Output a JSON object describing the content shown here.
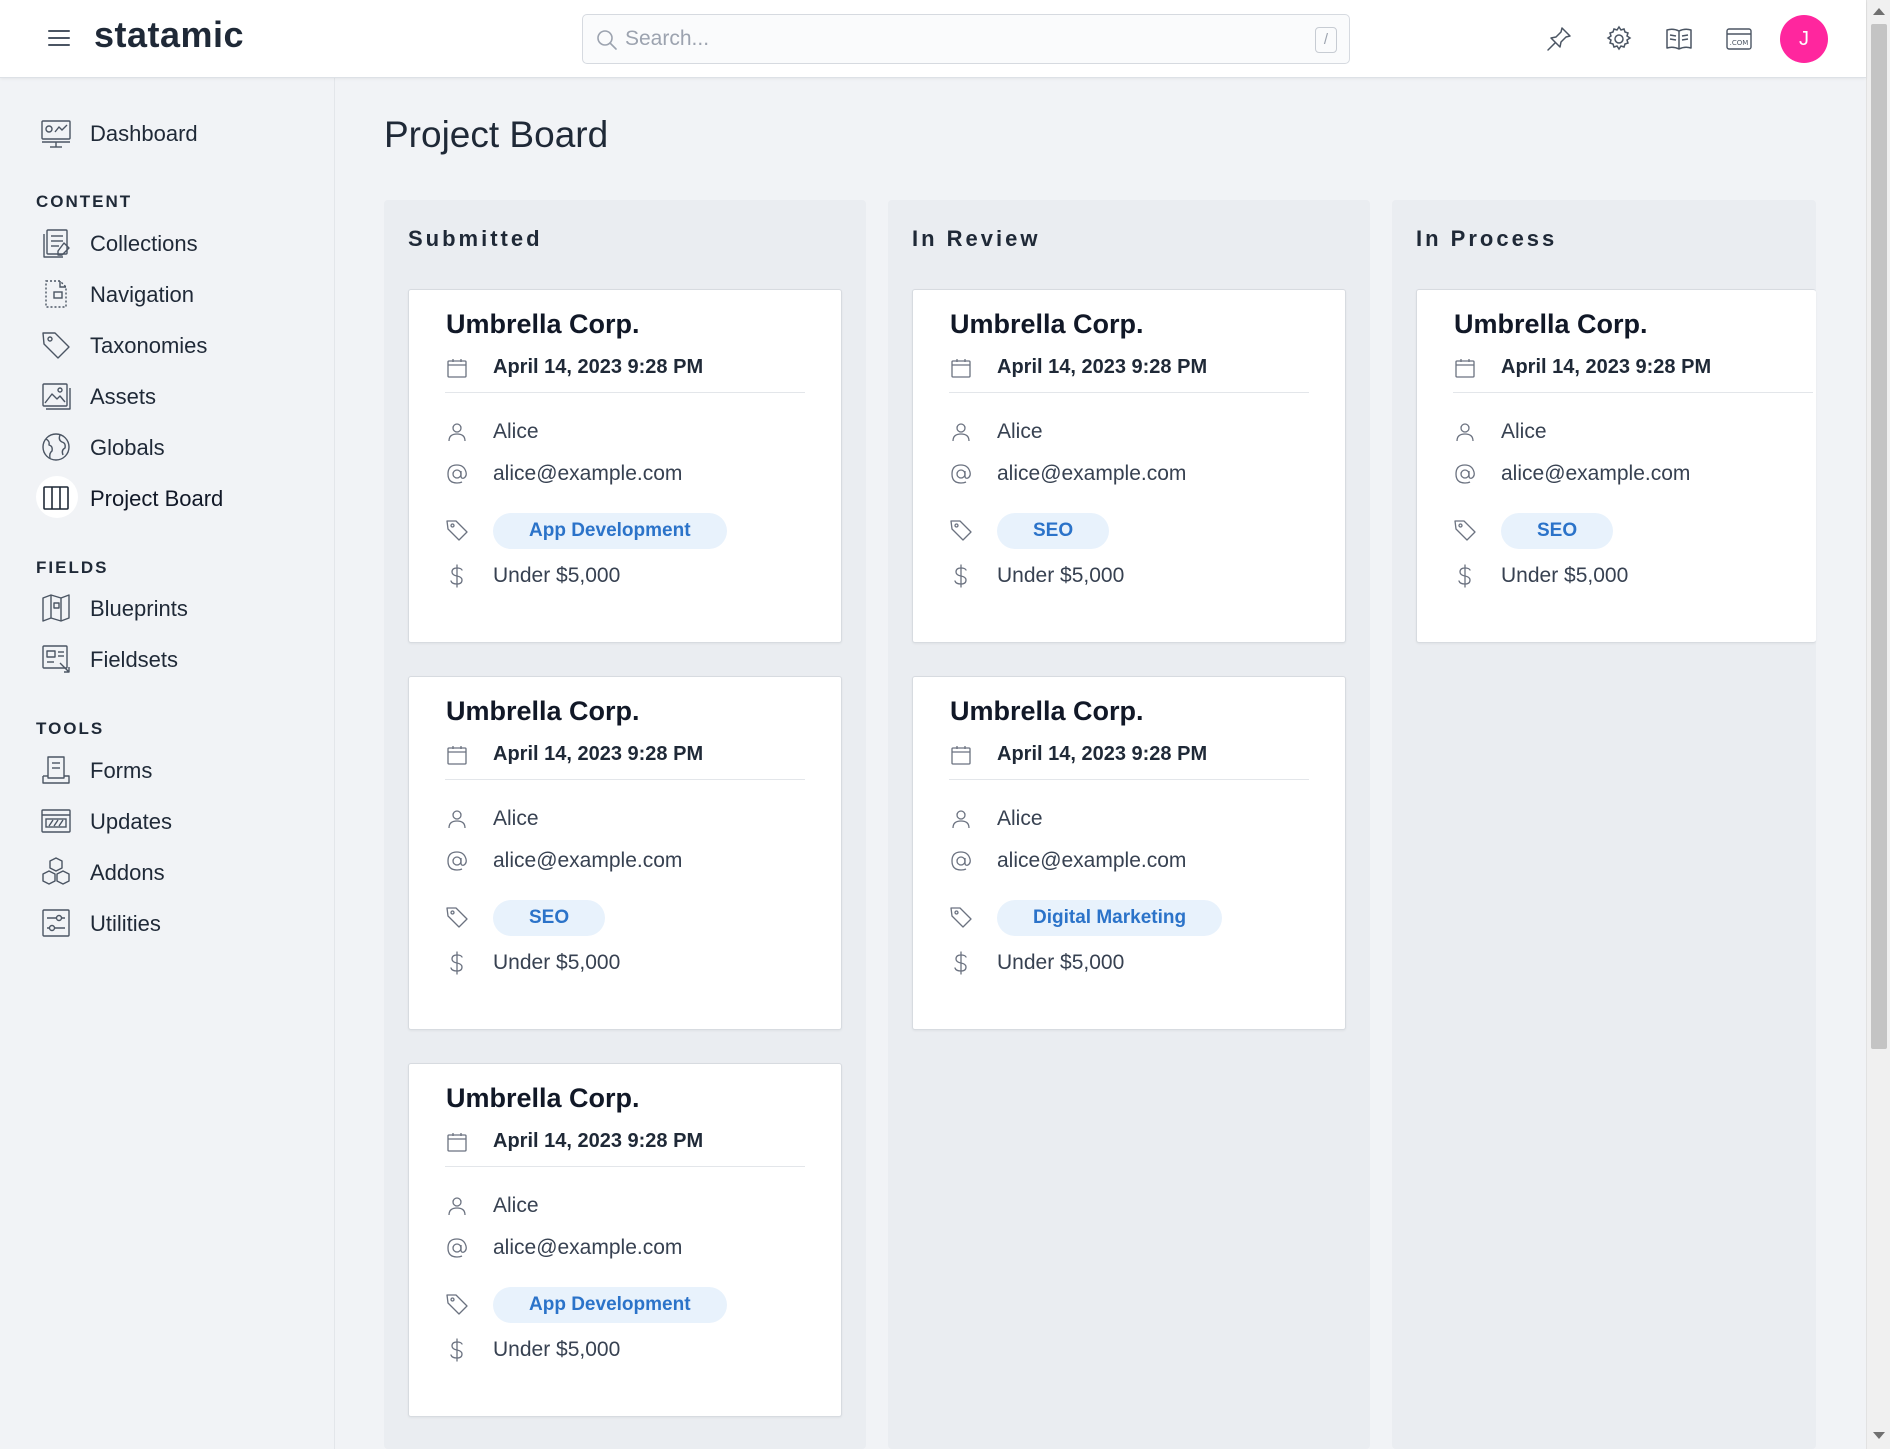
{
  "header": {
    "brand": "statamic",
    "search_placeholder": "Search...",
    "search_shortcut": "/",
    "icons": [
      "pin-icon",
      "gear-icon",
      "book-icon",
      "site-com-icon"
    ],
    "avatar_initial": "J",
    "avatar_color": "#ff269e"
  },
  "sidebar": {
    "dashboard": "Dashboard",
    "content_title": "CONTENT",
    "content_items": [
      {
        "label": "Collections",
        "icon": "collections-icon"
      },
      {
        "label": "Navigation",
        "icon": "navigation-icon"
      },
      {
        "label": "Taxonomies",
        "icon": "tag-icon"
      },
      {
        "label": "Assets",
        "icon": "assets-icon"
      },
      {
        "label": "Globals",
        "icon": "globe-icon"
      },
      {
        "label": "Project Board",
        "icon": "board-icon",
        "active": true
      }
    ],
    "fields_title": "FIELDS",
    "fields_items": [
      {
        "label": "Blueprints",
        "icon": "blueprint-icon"
      },
      {
        "label": "Fieldsets",
        "icon": "fieldset-icon"
      }
    ],
    "tools_title": "TOOLS",
    "tools_items": [
      {
        "label": "Forms",
        "icon": "forms-icon"
      },
      {
        "label": "Updates",
        "icon": "updates-icon"
      },
      {
        "label": "Addons",
        "icon": "addons-icon"
      },
      {
        "label": "Utilities",
        "icon": "utilities-icon"
      }
    ]
  },
  "main": {
    "title": "Project Board",
    "tag_color": "#2b73c9",
    "columns": [
      {
        "title": "Submitted",
        "cards": [
          {
            "company": "Umbrella Corp.",
            "date": "April 14, 2023 9:28 PM",
            "name": "Alice",
            "email": "alice@example.com",
            "tag": "App Development",
            "budget": "Under $5,000"
          },
          {
            "company": "Umbrella Corp.",
            "date": "April 14, 2023 9:28 PM",
            "name": "Alice",
            "email": "alice@example.com",
            "tag": "SEO",
            "budget": "Under $5,000"
          },
          {
            "company": "Umbrella Corp.",
            "date": "April 14, 2023 9:28 PM",
            "name": "Alice",
            "email": "alice@example.com",
            "tag": "App Development",
            "budget": "Under $5,000"
          }
        ]
      },
      {
        "title": "In Review",
        "cards": [
          {
            "company": "Umbrella Corp.",
            "date": "April 14, 2023 9:28 PM",
            "name": "Alice",
            "email": "alice@example.com",
            "tag": "SEO",
            "budget": "Under $5,000"
          },
          {
            "company": "Umbrella Corp.",
            "date": "April 14, 2023 9:28 PM",
            "name": "Alice",
            "email": "alice@example.com",
            "tag": "Digital Marketing",
            "budget": "Under $5,000"
          }
        ]
      },
      {
        "title": "In Process",
        "cards": [
          {
            "company": "Umbrella Corp.",
            "date": "April 14, 2023 9:28 PM",
            "name": "Alice",
            "email": "alice@example.com",
            "tag": "SEO",
            "budget": "Under $5,000"
          }
        ]
      }
    ]
  }
}
